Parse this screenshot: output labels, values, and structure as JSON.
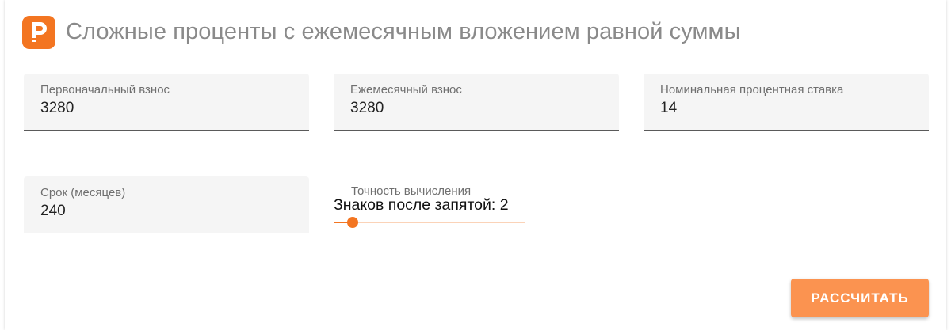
{
  "header": {
    "logo_icon": "orange-p-logo-icon",
    "title": "Сложные проценты с ежемесячным вложением равной суммы"
  },
  "fields": {
    "initial": {
      "label": "Первоначальный взнос",
      "value": "3280"
    },
    "monthly": {
      "label": "Ежемесячный взнос",
      "value": "3280"
    },
    "rate": {
      "label": "Номинальная процентная ставка",
      "value": "14"
    },
    "term": {
      "label": "Срок (месяцев)",
      "value": "240"
    }
  },
  "precision": {
    "label": "Точность вычисления",
    "value_text": "Знаков после запятой: 2",
    "slider_fraction": 0.1
  },
  "actions": {
    "calculate_label": "РАССЧИТАТЬ"
  },
  "colors": {
    "accent": "#f37521",
    "button": "#fb9350",
    "title": "#8a8a8a"
  }
}
